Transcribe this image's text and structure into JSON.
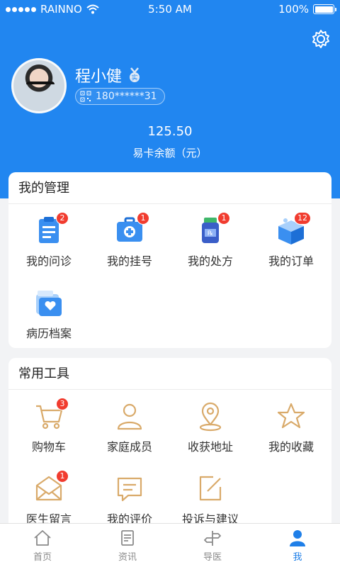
{
  "status_bar": {
    "carrier": "RAINNO",
    "time": "5:50 AM",
    "battery": "100%"
  },
  "profile": {
    "name": "程小健",
    "phone": "180******31",
    "badge_text": "实"
  },
  "wallet": {
    "balance": "125.50",
    "label": "易卡余额（元）"
  },
  "management": {
    "title": "我的管理",
    "items": [
      {
        "label": "我的问诊",
        "badge": "2",
        "icon": "clipboard-icon"
      },
      {
        "label": "我的挂号",
        "badge": "1",
        "icon": "medical-kit-icon"
      },
      {
        "label": "我的处方",
        "badge": "1",
        "icon": "prescription-bottle-icon"
      },
      {
        "label": "我的订单",
        "badge": "12",
        "icon": "package-box-icon"
      },
      {
        "label": "病历档案",
        "badge": "",
        "icon": "medical-record-folder-icon"
      }
    ]
  },
  "tools": {
    "title": "常用工具",
    "items": [
      {
        "label": "购物车",
        "badge": "3",
        "icon": "shopping-cart-icon"
      },
      {
        "label": "家庭成员",
        "badge": "",
        "icon": "family-member-icon"
      },
      {
        "label": "收获地址",
        "badge": "",
        "icon": "location-pin-icon"
      },
      {
        "label": "我的收藏",
        "badge": "",
        "icon": "star-icon"
      },
      {
        "label": "医生留言",
        "badge": "1",
        "icon": "envelope-icon"
      },
      {
        "label": "我的评价",
        "badge": "",
        "icon": "comment-icon"
      },
      {
        "label": "投诉与建议",
        "badge": "",
        "icon": "edit-icon"
      }
    ]
  },
  "tabbar": {
    "items": [
      {
        "label": "首页",
        "icon": "home-icon",
        "active": false
      },
      {
        "label": "资讯",
        "icon": "news-icon",
        "active": false
      },
      {
        "label": "导医",
        "icon": "signpost-icon",
        "active": false
      },
      {
        "label": "我",
        "icon": "user-icon",
        "active": true
      }
    ]
  },
  "colors": {
    "primary": "#2186f0",
    "badge": "#f13c2f",
    "tool_icon": "#d9aa6a"
  }
}
